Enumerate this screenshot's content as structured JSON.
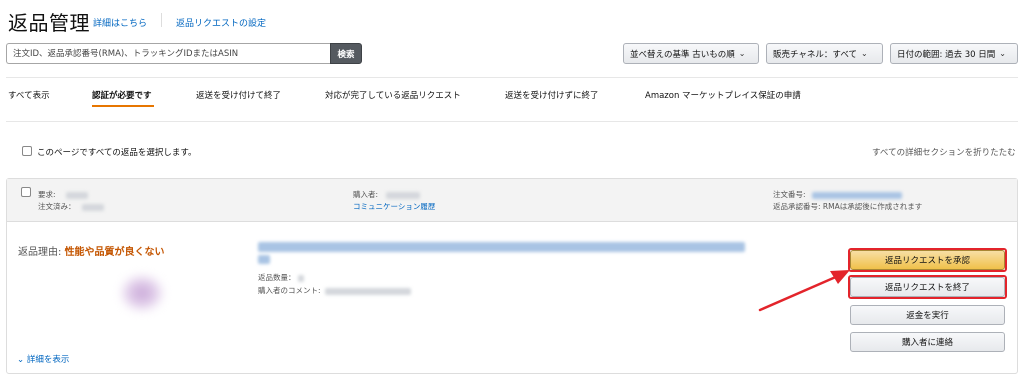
{
  "header": {
    "title": "返品管理",
    "details_link": "詳細はこちら",
    "settings_link": "返品リクエストの設定"
  },
  "search": {
    "placeholder": "注文ID、返品承認番号(RMA)、トラッキングIDまたはASIN",
    "button_label": "検索"
  },
  "filters": {
    "sort": "並べ替えの基準 古いもの順",
    "channel": "販売チャネル：すべて",
    "date_range": "日付の範囲: 過去 30 日間"
  },
  "tabs": [
    {
      "label": "すべて表示"
    },
    {
      "label": "認証が必要です"
    },
    {
      "label": "返送を受け付けて終了"
    },
    {
      "label": "対応が完了している返品リクエスト"
    },
    {
      "label": "返送を受け付けずに終了"
    },
    {
      "label": "Amazon マーケットプレイス保証の申請"
    }
  ],
  "list": {
    "select_all_label": "このページですべての返品を選択します。",
    "collapse_all": "すべての詳細セクションを折りたたむ"
  },
  "card": {
    "request_label": "要求:",
    "ordered_label": "注文済み：",
    "buyer_label": "購入者:",
    "contact_history_link": "コミュニケーション履歴",
    "order_number_label": "注文番号:",
    "rma_label": "返品承認番号:",
    "rma_value": "RMAは承認後に作成されます",
    "reason_label": "返品理由:",
    "reason_value": "性能や品質が良くない",
    "quantity_label": "返品数量：",
    "buyer_comment_label": "購入者のコメント:",
    "show_details": "詳細を表示",
    "actions": {
      "approve": "返品リクエストを承認",
      "close": "返品リクエストを終了",
      "refund": "返金を実行",
      "contact": "購入者に連絡"
    }
  },
  "colors": {
    "accent": "#e77600",
    "reason": "#c45500",
    "link": "#0066c0",
    "highlight": "#e3242b",
    "primary_button": "#f0c14b"
  }
}
